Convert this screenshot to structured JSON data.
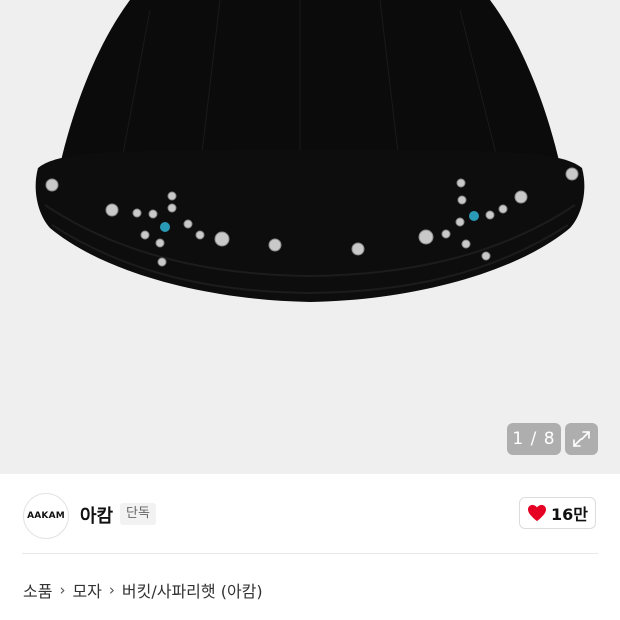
{
  "gallery": {
    "counter": "1 / 8",
    "expand_icon": "expand-icon"
  },
  "store": {
    "logo_text": "AAKAM",
    "name": "아캄",
    "badge": "단독",
    "like_count": "16만",
    "like_icon": "heart-icon",
    "like_color": "#e60023"
  },
  "breadcrumb": {
    "items": [
      "소품",
      "모자",
      "버킷/사파리햇 (아캄)"
    ],
    "separator_icon": "chevron-right-icon"
  }
}
